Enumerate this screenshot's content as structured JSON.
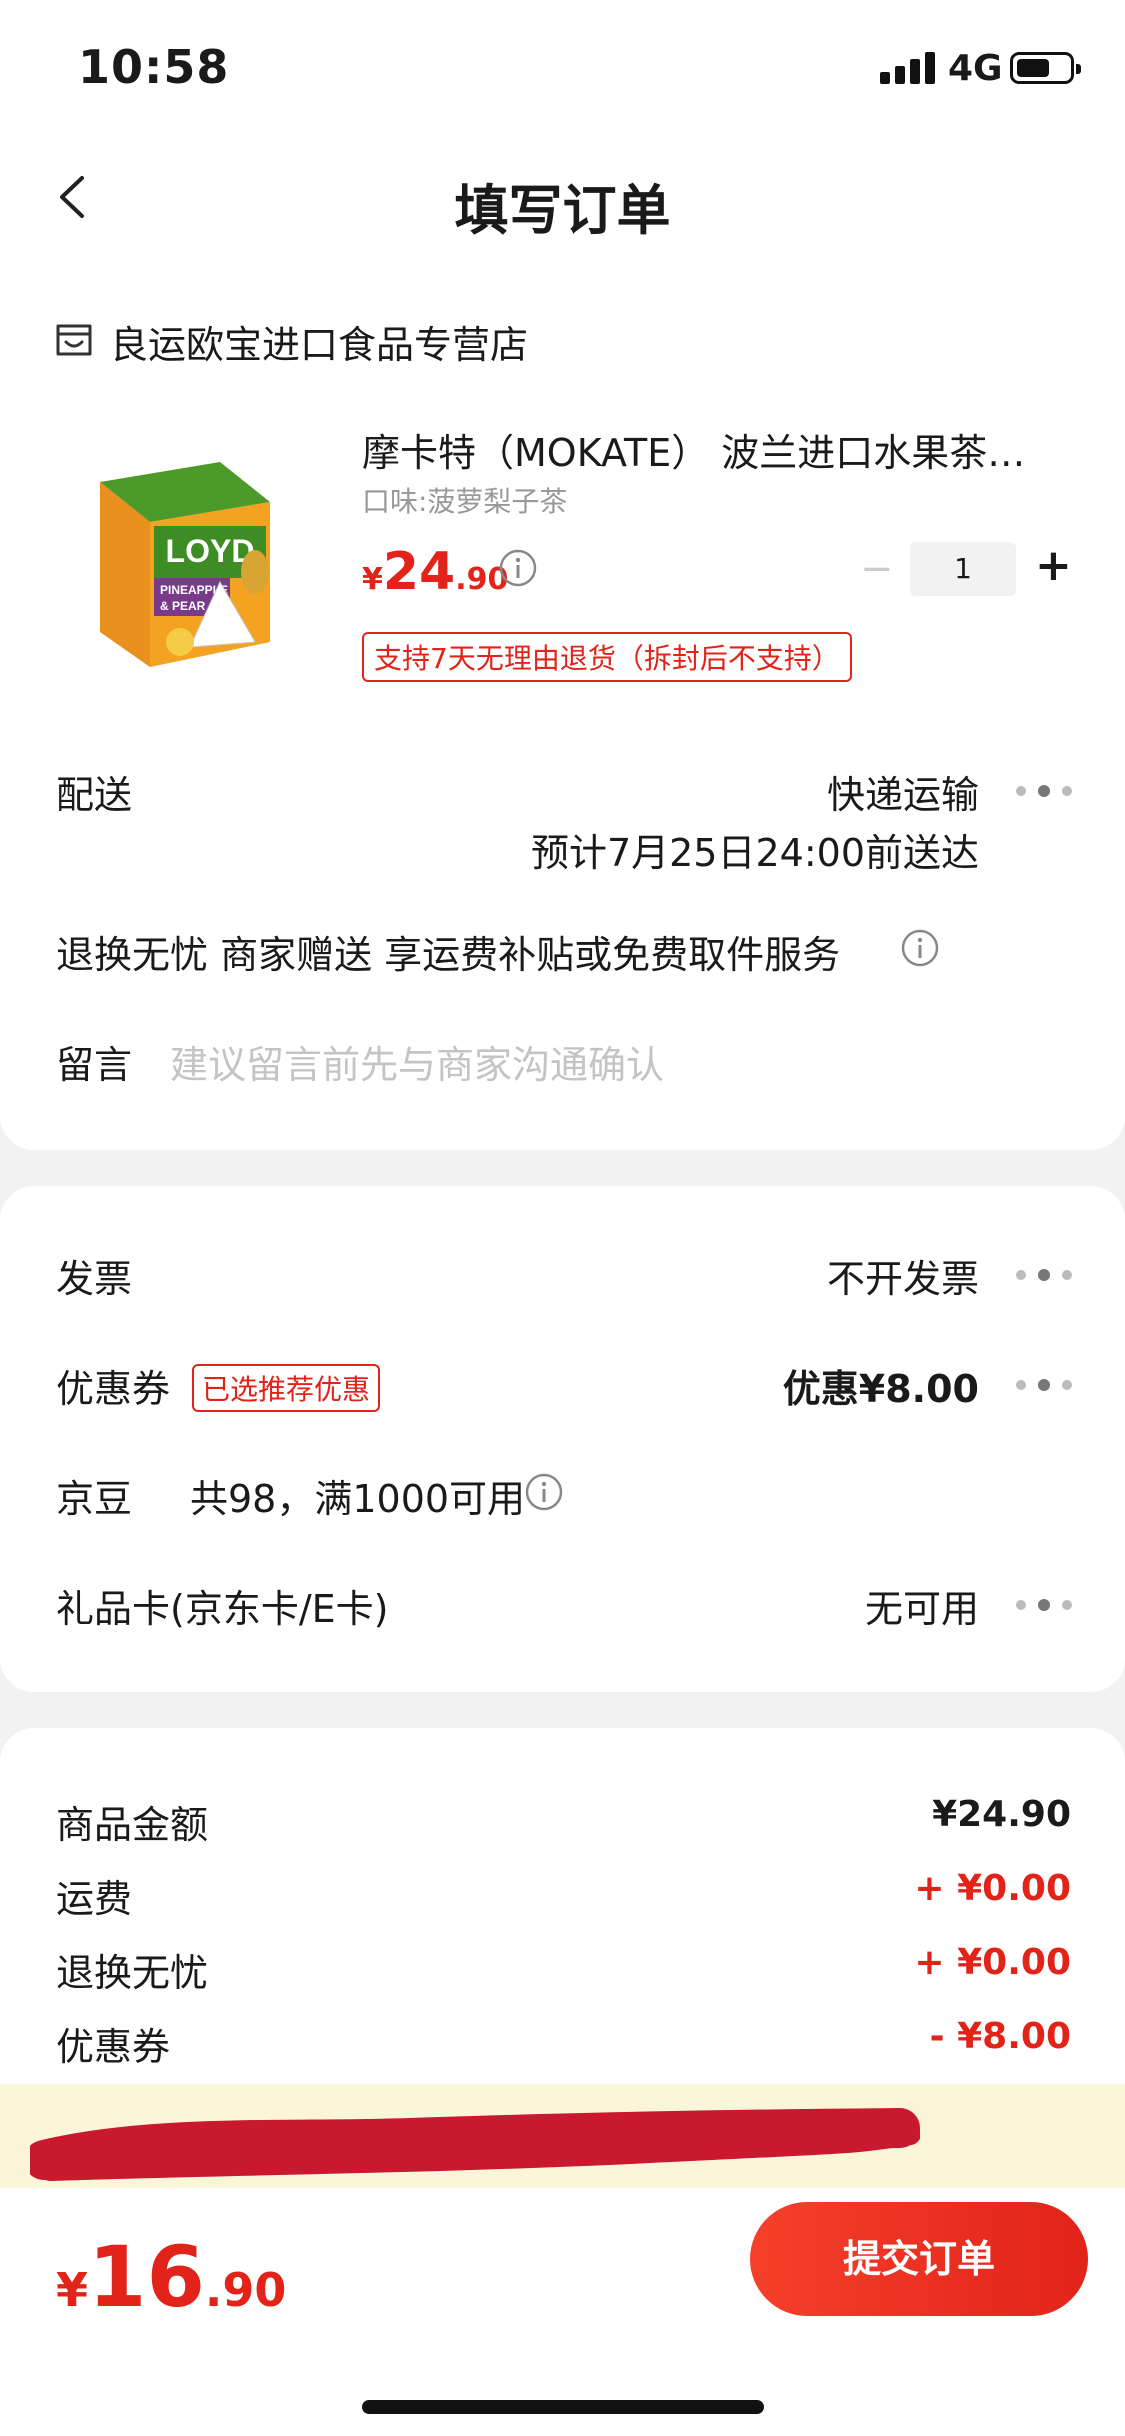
{
  "status_bar": {
    "time": "10:58",
    "network": "4G"
  },
  "nav": {
    "title": "填写订单"
  },
  "store": {
    "name": "良运欧宝进口食品专营店"
  },
  "product": {
    "title": "摩卡特（MOKATE） 波兰进口水果茶…",
    "spec": "口味:菠萝梨子茶",
    "price_symbol": "¥",
    "price_int": "24",
    "price_dec": ".90",
    "quantity": "1",
    "minus": "−",
    "plus": "+",
    "return_policy": "支持7天无理由退货（拆封后不支持）",
    "image": {
      "brand": "LOYD",
      "line1": "PINEAPPLE",
      "line2": "& PEAR"
    }
  },
  "delivery": {
    "label": "配送",
    "method": "快递运输",
    "eta": "预计7月25日24:00前送达"
  },
  "service": {
    "text": "退换无忧 商家赠送 享运费补贴或免费取件服务"
  },
  "message": {
    "label": "留言",
    "placeholder": "建议留言前先与商家沟通确认"
  },
  "invoice": {
    "label": "发票",
    "value": "不开发票"
  },
  "coupon": {
    "label": "优惠券",
    "tag": "已选推荐优惠",
    "value": "优惠¥8.00"
  },
  "jingdou": {
    "label": "京豆",
    "text": "共98，满1000可用"
  },
  "giftcard": {
    "label": "礼品卡(京东卡/E卡)",
    "value": "无可用"
  },
  "summary": [
    {
      "label": "商品金额",
      "value": "¥24.90"
    },
    {
      "label": "运费",
      "value": "+ ¥0.00"
    },
    {
      "label": "退换无忧",
      "value": "+ ¥0.00"
    },
    {
      "label": "优惠券",
      "value": "- ¥8.00"
    }
  ],
  "footer": {
    "total_symbol": "¥",
    "total_int": "16",
    "total_dec": ".90",
    "submit": "提交订单"
  },
  "colors": {
    "accent": "#e2231a",
    "notice_bg": "#fbf6da",
    "page_bg": "#f2f2f2"
  }
}
